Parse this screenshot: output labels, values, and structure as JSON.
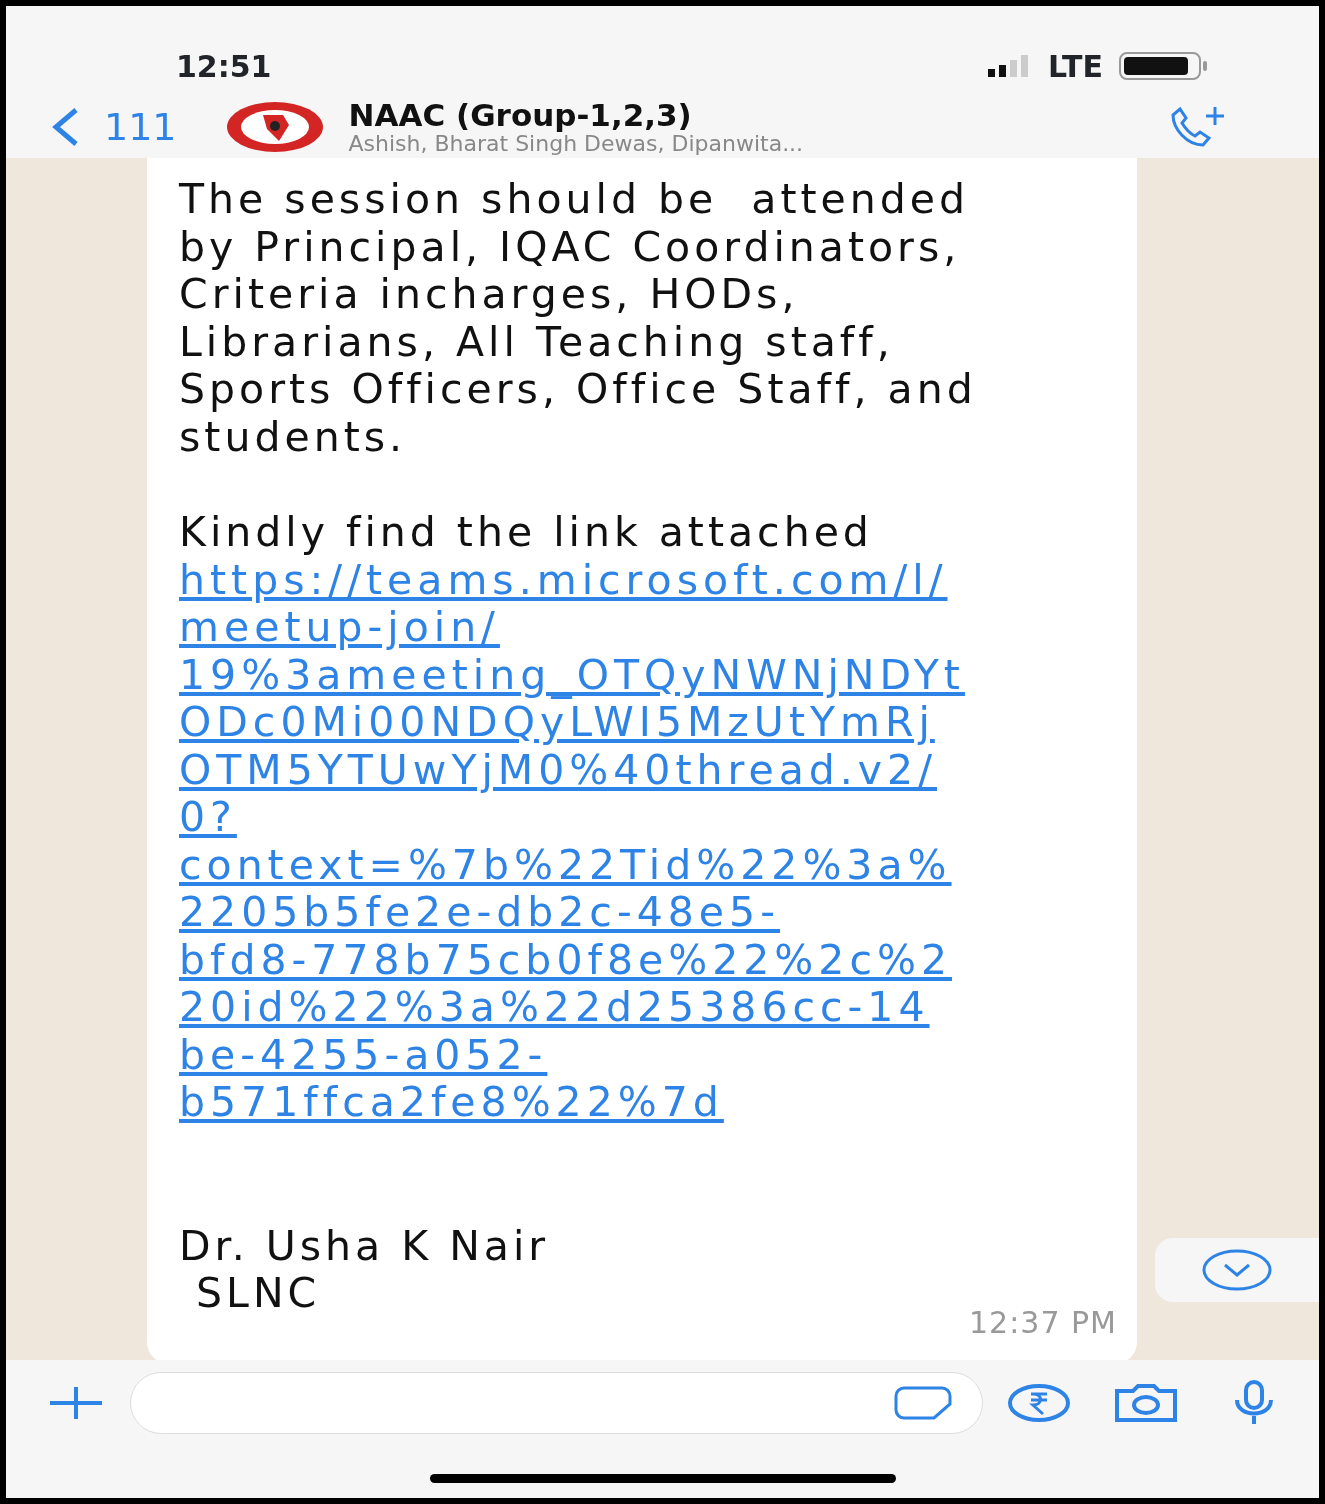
{
  "status_bar": {
    "time": "12:51",
    "network": "LTE"
  },
  "header": {
    "back_count": "111",
    "title": "NAAC (Group-1,2,3)",
    "subtitle": "Ashish, Bharat Singh Dewas, Dipanwita..."
  },
  "message": {
    "paragraphs": [
      [
        "The session should be  attended",
        "by Principal, IQAC Coordinators,",
        "Criteria incharges, HODs,",
        "Librarians, All Teaching staff,",
        "Sports Officers, Office Staff, and",
        "students."
      ],
      [
        "Kindly find the link attached"
      ]
    ],
    "link_lines": [
      "https://teams.microsoft.com/l/",
      "meetup-join/",
      "19%3ameeting_OTQyNWNjNDYt",
      "ODc0Mi00NDQyLWI5MzUtYmRj",
      "OTM5YTUwYjM0%40thread.v2/",
      "0?",
      "context=%7b%22Tid%22%3a%",
      "2205b5fe2e-db2c-48e5-",
      "bfd8-778b75cb0f8e%22%2c%2",
      "20id%22%3a%22d25386cc-14",
      "be-4255-a052-",
      "b571ffca2fe8%22%7d"
    ],
    "signature": [
      "Dr. Usha K Nair",
      " SLNC"
    ],
    "time": "12:37 PM"
  }
}
